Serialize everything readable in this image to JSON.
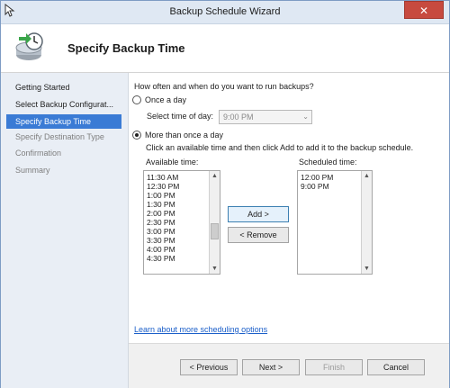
{
  "window": {
    "title": "Backup Schedule Wizard",
    "close_label": "✕"
  },
  "header": {
    "page_title": "Specify Backup Time"
  },
  "sidebar": {
    "items": [
      {
        "label": "Getting Started",
        "state": "normal"
      },
      {
        "label": "Select Backup Configurat...",
        "state": "normal"
      },
      {
        "label": "Specify Backup Time",
        "state": "selected"
      },
      {
        "label": "Specify Destination Type",
        "state": "disabled"
      },
      {
        "label": "Confirmation",
        "state": "disabled"
      },
      {
        "label": "Summary",
        "state": "disabled"
      }
    ]
  },
  "main": {
    "question": "How often and when do you want to run backups?",
    "once_a_day_label": "Once a day",
    "select_time_label": "Select time of day:",
    "select_time_value": "9:00 PM",
    "more_than_once_label": "More than once a day",
    "instruction": "Click an available time and then click Add to add it to the backup schedule.",
    "available_label": "Available time:",
    "scheduled_label": "Scheduled time:",
    "available_times": [
      "11:30 AM",
      "12:30 PM",
      "1:00 PM",
      "1:30 PM",
      "2:00 PM",
      "2:30 PM",
      "3:00 PM",
      "3:30 PM",
      "4:00 PM",
      "4:30 PM"
    ],
    "scheduled_times": [
      "12:00 PM",
      "9:00 PM"
    ],
    "add_label": "Add >",
    "remove_label": "< Remove",
    "link_text": "Learn about more scheduling options"
  },
  "footer": {
    "previous_label": "< Previous",
    "next_label": "Next >",
    "finish_label": "Finish",
    "cancel_label": "Cancel"
  },
  "colors": {
    "selected_nav": "#3a7bd5",
    "link": "#1a5ec9",
    "close_button": "#c74a3f"
  }
}
